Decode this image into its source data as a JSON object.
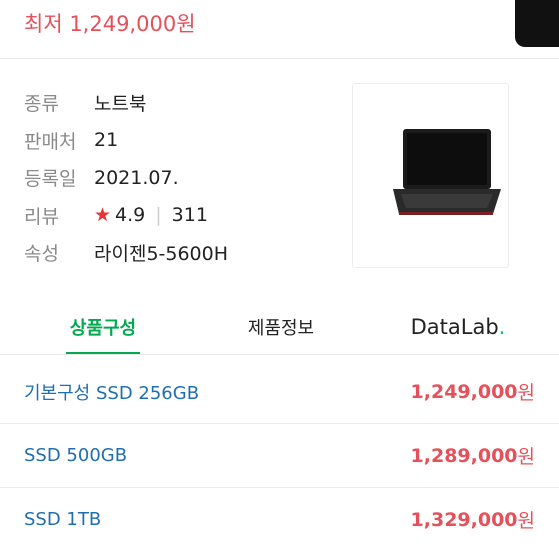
{
  "header": {
    "lowest_price": "최저 1,249,000원"
  },
  "info": {
    "rows": [
      {
        "label": "종류",
        "value": "노트북"
      },
      {
        "label": "판매처",
        "value": "21"
      },
      {
        "label": "등록일",
        "value": "2021.07."
      },
      {
        "label": "리뷰",
        "rating": "4.9",
        "count": "311"
      },
      {
        "label": "속성",
        "value": "라이젠5-5600H"
      }
    ]
  },
  "tabs": [
    {
      "label": "상품구성"
    },
    {
      "label": "제품정보"
    },
    {
      "label": "DataLab",
      "dot": "."
    }
  ],
  "options": [
    {
      "name": "기본구성 SSD 256GB",
      "price": "1,249,000",
      "unit": "원"
    },
    {
      "name": "SSD 500GB",
      "price": "1,289,000",
      "unit": "원"
    },
    {
      "name": "SSD 1TB",
      "price": "1,329,000",
      "unit": "원"
    }
  ],
  "colors": {
    "accent_green": "#03a94f",
    "price_red": "#e5505a",
    "link_blue": "#1f6fb0"
  },
  "icons": {
    "rating": "star-icon",
    "thumbnail": "laptop-thumbnail"
  }
}
